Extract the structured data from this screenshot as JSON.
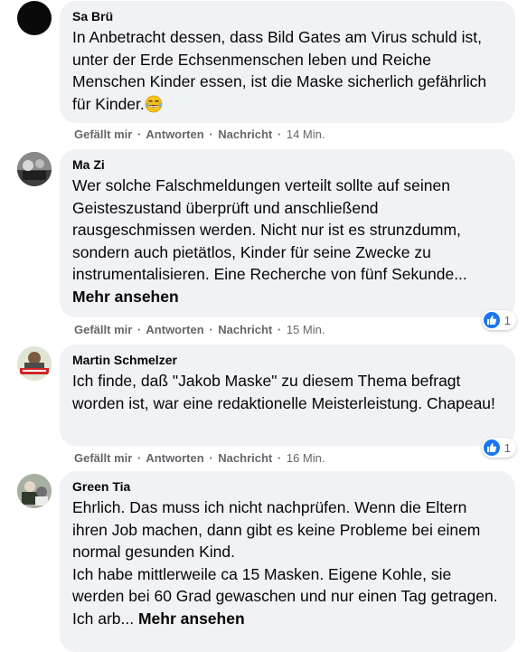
{
  "comments": [
    {
      "author": "Sa Brü",
      "text": "In Anbetracht dessen, dass Bild Gates am Virus schuld ist, unter der Erde Echsenmenschen leben und Reiche Menschen Kinder essen, ist die Maske sicherlich gefährlich für Kinder.",
      "emoji": "crying-laughing-emoji",
      "like_label": "Gefällt mir",
      "reply_label": "Antworten",
      "message_label": "Nachricht",
      "time": "14 Min."
    },
    {
      "author": "Ma Zi",
      "text": "Wer solche Falschmeldungen verteilt sollte auf seinen Geisteszustand überprüft und anschließend rausgeschmissen werden. Nicht nur ist es strunzdumm, sondern auch pietätlos, Kinder für seine Zwecke zu instrumentalisieren. Eine Recherche von fünf Sekunde...",
      "more_label": "Mehr ansehen",
      "like_label": "Gefällt mir",
      "reply_label": "Antworten",
      "message_label": "Nachricht",
      "time": "15 Min.",
      "reaction_count": "1"
    },
    {
      "author": "Martin Schmelzer",
      "text": "Ich finde, daß \"Jakob Maske\" zu diesem Thema befragt worden ist, war eine redaktionelle Meisterleistung. Chapeau!",
      "like_label": "Gefällt mir",
      "reply_label": "Antworten",
      "message_label": "Nachricht",
      "time": "16 Min.",
      "reaction_count": "1"
    },
    {
      "author": "Green Tia",
      "text_line1": "Ehrlich. Das muss ich nicht nachprüfen. Wenn die Eltern ihren Job machen, dann gibt es keine Probleme bei einem normal gesunden Kind.",
      "text_line2": "Ich habe mittlerweile ca 15 Masken. Eigene Kohle, sie werden bei 60 Grad gewaschen und nur einen Tag getragen. Ich arb...",
      "more_label": "Mehr ansehen"
    }
  ],
  "separator": "·",
  "colors": {
    "bubble": "#f0f2f5",
    "meta": "#65676b",
    "like_blue": "#1877f2"
  }
}
